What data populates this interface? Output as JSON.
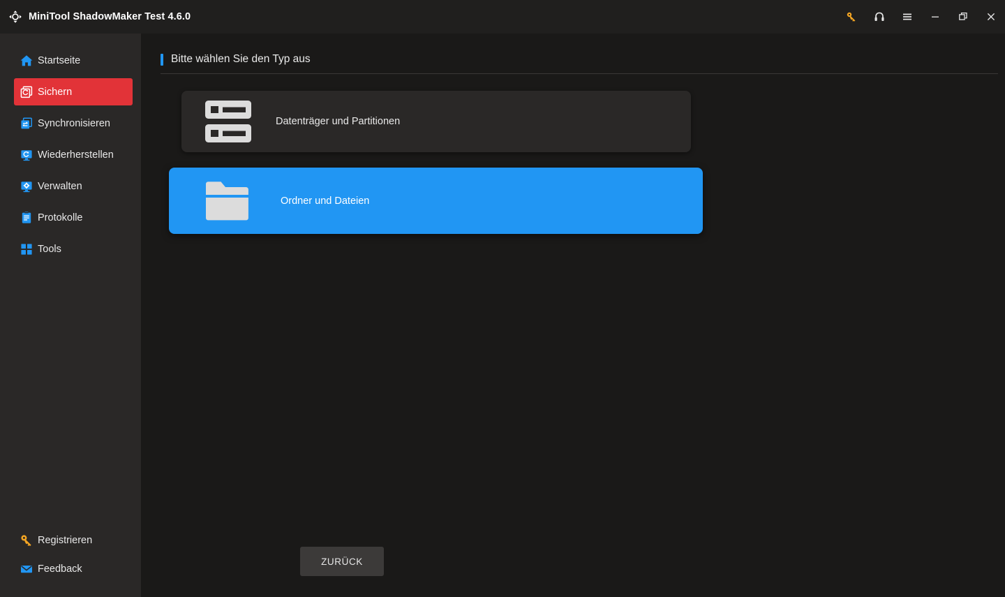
{
  "window": {
    "title": "MiniTool ShadowMaker Test 4.6.0",
    "logo_icon": "shadowmaker-arrows-logo",
    "controls": [
      {
        "name": "register-key-icon",
        "icon": "key-icon",
        "color": "#f5a623"
      },
      {
        "name": "support-icon",
        "icon": "headphones-icon",
        "color": "#e6e6e6"
      },
      {
        "name": "menu-icon",
        "icon": "hamburger-menu-icon",
        "color": "#e6e6e6"
      },
      {
        "name": "minimize-button",
        "icon": "minimize-icon",
        "color": "#e6e6e6"
      },
      {
        "name": "restore-button",
        "icon": "restore-icon",
        "color": "#e6e6e6"
      },
      {
        "name": "close-button",
        "icon": "close-icon",
        "color": "#e6e6e6"
      }
    ]
  },
  "sidebar": {
    "items": [
      {
        "label": "Startseite",
        "icon": "home-icon",
        "active": false
      },
      {
        "label": "Sichern",
        "icon": "backup-icon",
        "active": true
      },
      {
        "label": "Synchronisieren",
        "icon": "sync-icon",
        "active": false
      },
      {
        "label": "Wiederherstellen",
        "icon": "restore-monitor-icon",
        "active": false
      },
      {
        "label": "Verwalten",
        "icon": "manage-gear-monitor-icon",
        "active": false
      },
      {
        "label": "Protokolle",
        "icon": "logs-clipboard-icon",
        "active": false
      },
      {
        "label": "Tools",
        "icon": "tools-grid-icon",
        "active": false
      }
    ],
    "bottom_items": [
      {
        "label": "Registrieren",
        "icon": "key-icon"
      },
      {
        "label": "Feedback",
        "icon": "envelope-icon"
      }
    ]
  },
  "main": {
    "header_title": "Bitte wählen Sie den Typ aus",
    "cards": [
      {
        "label": "Datenträger und Partitionen",
        "icon": "disk-partitions-icon",
        "selected": false
      },
      {
        "label": "Ordner und Dateien",
        "icon": "folder-icon",
        "selected": true
      }
    ],
    "back_button": "ZURÜCK"
  },
  "colors": {
    "accent_blue": "#2196f3",
    "active_red": "#e23338",
    "titlebar_bg": "#201f1e",
    "sidebar_bg": "#2a2827",
    "main_bg": "#1a1918",
    "card_bg": "#2a2827",
    "key_yellow": "#f5a623"
  }
}
